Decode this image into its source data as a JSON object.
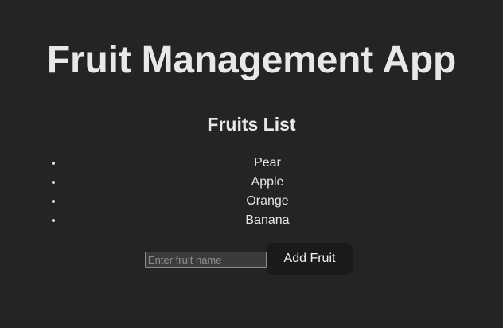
{
  "header": {
    "title": "Fruit Management App"
  },
  "list": {
    "heading": "Fruits List",
    "items": [
      {
        "label": "Pear"
      },
      {
        "label": "Apple"
      },
      {
        "label": "Orange"
      },
      {
        "label": "Banana"
      }
    ]
  },
  "form": {
    "input_placeholder": "Enter fruit name",
    "input_value": "",
    "add_label": "Add Fruit"
  },
  "colors": {
    "background": "#242424",
    "text": "#e8e8e8",
    "button_background": "#1a1a1a"
  }
}
